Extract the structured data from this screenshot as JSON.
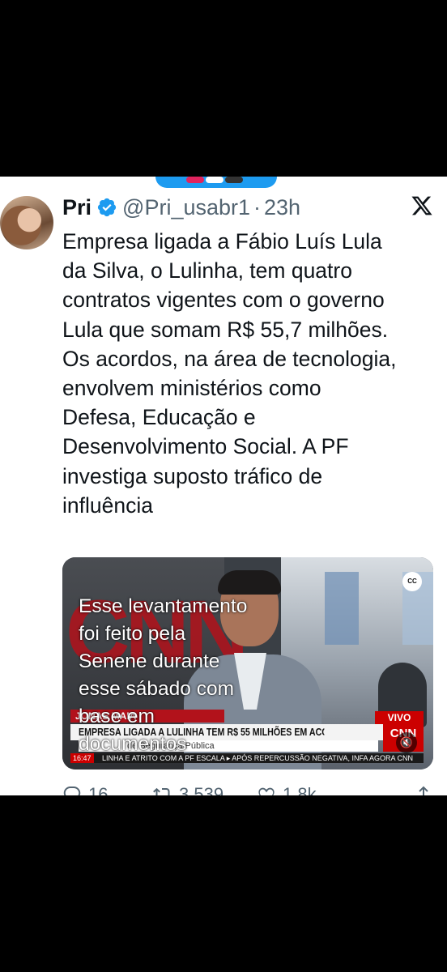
{
  "tweet": {
    "author_name": "Pri",
    "handle": "@Pri_usabr1",
    "separator": "·",
    "time": "23h",
    "text": "Empresa ligada a Fábio Luís Lula\nda Silva, o Lulinha, tem quatro\ncontratos vigentes com o governo\nLula que somam R$ 55,7 milhões.\nOs acordos, na área de tecnologia,\nenvolvem ministérios como\nDefesa, Educação e\nDesenvolvimento Social. A PF\ninvestiga suposto tráfico de\ninfluência"
  },
  "video": {
    "caption": "Esse levantamento\nfoi feito pela\nSenene durante\nesse sábado com\nbase em\ndocumentos",
    "name_strip": "JONAS MAIA",
    "live_label": "VIVO",
    "headline": "EMPRESA LIGADA A LULINHA TEM R$ 55 MILHÕES EM ACORDOS",
    "subline": "de Segurança Pública",
    "brand": "CNN",
    "ticker_time": "16:47",
    "ticker_text": "LINHA E ATRITO COM A PF ESCALA   ▸ APÓS REPERCUSSÃO NEGATIVA, INFA AGORA CNN",
    "cc_label": "CC"
  },
  "actions": {
    "replies": "16",
    "retweets": "3.539",
    "likes": "1,8k"
  },
  "icons": [
    "verified-badge-icon",
    "x-logo-icon",
    "reply-icon",
    "retweet-icon",
    "like-icon",
    "share-icon",
    "mute-icon"
  ],
  "colors": {
    "verified": "#1d9bf0",
    "text": "#0f1419",
    "muted": "#536471",
    "cnn_red": "#cc0000"
  }
}
